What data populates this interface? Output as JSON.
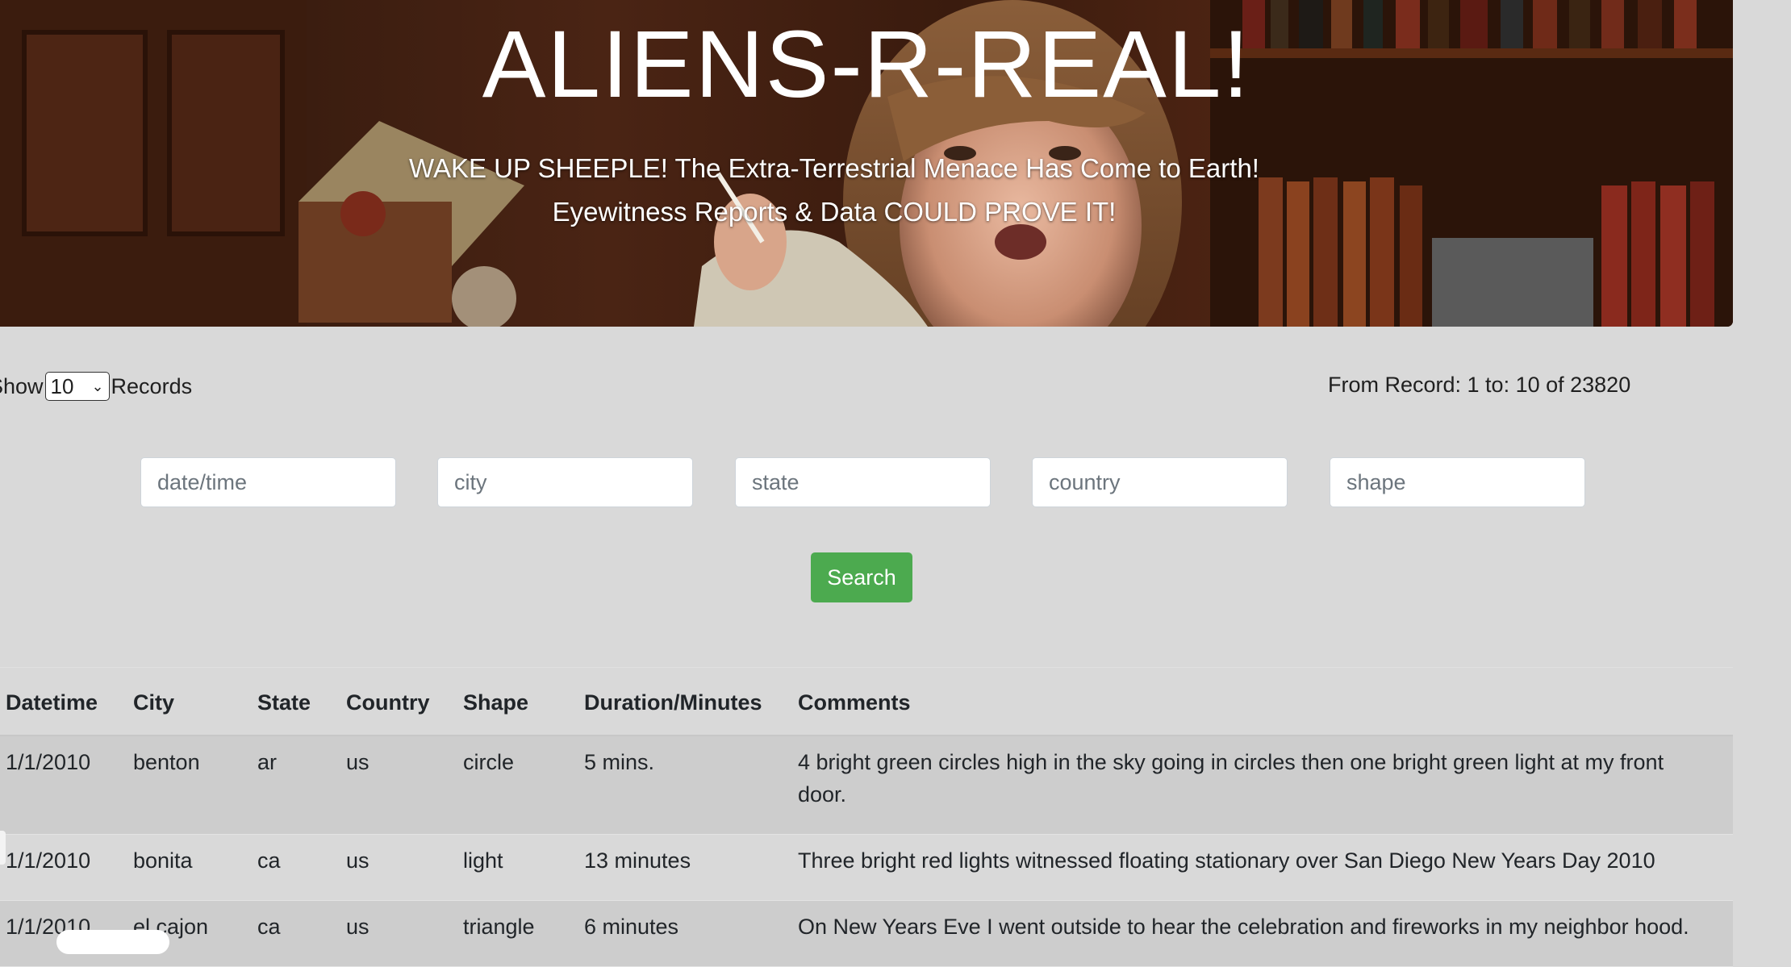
{
  "banner": {
    "title": "ALIENS-R-REAL!",
    "subtitle_line1": "WAKE UP SHEEPLE! The Extra-Terrestrial Menace Has Come to Earth!",
    "subtitle_line2": "Eyewitness Reports & Data COULD PROVE IT!"
  },
  "controls": {
    "show_label": "Show",
    "records_label": "Records",
    "show_value": "10",
    "record_info": "From Record: 1 to: 10 of 23820"
  },
  "filters": {
    "datetime_placeholder": "date/time",
    "city_placeholder": "city",
    "state_placeholder": "state",
    "country_placeholder": "country",
    "shape_placeholder": "shape"
  },
  "search": {
    "label": "Search",
    "color": "#4caa4f"
  },
  "table": {
    "headers": [
      "Datetime",
      "City",
      "State",
      "Country",
      "Shape",
      "Duration/Minutes",
      "Comments"
    ],
    "rows": [
      [
        "1/1/2010",
        "benton",
        "ar",
        "us",
        "circle",
        "5 mins.",
        "4 bright green circles high in the sky going in circles then one bright green light at my front door."
      ],
      [
        "1/1/2010",
        "bonita",
        "ca",
        "us",
        "light",
        "13 minutes",
        "Three bright red lights witnessed floating stationary over San Diego New Years Day 2010"
      ],
      [
        "1/1/2010",
        "el cajon",
        "ca",
        "us",
        "triangle",
        "6 minutes",
        "On New Years Eve I went outside to hear the celebration and fireworks in my neighbor hood."
      ]
    ]
  }
}
